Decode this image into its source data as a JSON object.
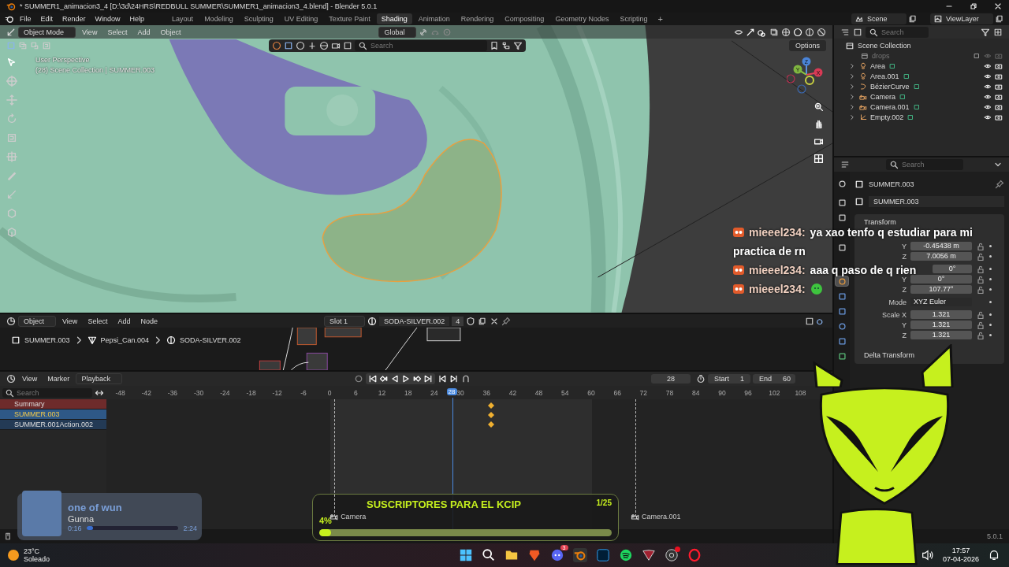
{
  "window": {
    "title": "* SUMMER1_animacion3_4 [D:\\3d\\24HRS\\REDBULL SUMMER\\SUMMER1_animacion3_4.blend] - Blender 5.0.1"
  },
  "menu": [
    "File",
    "Edit",
    "Render",
    "Window",
    "Help"
  ],
  "workspaces": [
    {
      "label": "Layout",
      "selected": false
    },
    {
      "label": "Modeling",
      "selected": false
    },
    {
      "label": "Sculpting",
      "selected": false
    },
    {
      "label": "UV Editing",
      "selected": false
    },
    {
      "label": "Texture Paint",
      "selected": false
    },
    {
      "label": "Shading",
      "selected": true
    },
    {
      "label": "Animation",
      "selected": false
    },
    {
      "label": "Rendering",
      "selected": false
    },
    {
      "label": "Compositing",
      "selected": false
    },
    {
      "label": "Geometry Nodes",
      "selected": false
    },
    {
      "label": "Scripting",
      "selected": false
    }
  ],
  "add_workspace": "+",
  "scene": "Scene",
  "view_layer": "ViewLayer",
  "viewport": {
    "mode": "Object Mode",
    "menus": [
      "View",
      "Select",
      "Add",
      "Object"
    ],
    "orientation": "Global",
    "search_placeholder": "Search",
    "options": "Options",
    "perspective": "User Perspective",
    "collection_info": "(28) Scene Collection | SUMMER.003",
    "gizmo_axes": [
      "Z",
      "Y",
      "X"
    ]
  },
  "outliner": {
    "search_placeholder": "Search",
    "root": "Scene Collection",
    "items": [
      {
        "name": "drops",
        "kind": "collection",
        "disabled": true
      },
      {
        "name": "Area",
        "kind": "light",
        "disabled": false
      },
      {
        "name": "Area.001",
        "kind": "light",
        "disabled": false
      },
      {
        "name": "BézierCurve",
        "kind": "curve",
        "disabled": false
      },
      {
        "name": "Camera",
        "kind": "camera",
        "disabled": false
      },
      {
        "name": "Camera.001",
        "kind": "camera",
        "disabled": false
      },
      {
        "name": "Empty.002",
        "kind": "empty",
        "disabled": false
      }
    ]
  },
  "properties": {
    "search_placeholder": "Search",
    "tab_groups": [
      [
        {
          "selected": false,
          "covered": false
        }
      ],
      [
        {
          "selected": false,
          "covered": false
        },
        {
          "selected": false,
          "covered": false
        },
        {
          "selected": false,
          "covered": true
        },
        {
          "selected": false,
          "covered": false
        },
        {
          "selected": false,
          "covered": true
        }
      ],
      [
        {
          "selected": true,
          "covered": false
        },
        {
          "selected": false,
          "covered": false
        },
        {
          "selected": false,
          "covered": false
        },
        {
          "selected": false,
          "covered": false
        },
        {
          "selected": false,
          "covered": false
        },
        {
          "selected": false,
          "covered": false
        }
      ]
    ],
    "object": "SUMMER.003",
    "object_field": "SUMMER.003",
    "panel": "Transform",
    "groups": [
      [
        {
          "kind": "blank"
        },
        {
          "kind": "field",
          "label": "Y",
          "value": "-0.45438 m"
        },
        {
          "kind": "field",
          "label": "Z",
          "value": "7.0056 m"
        }
      ],
      [
        {
          "kind": "stub",
          "value": "0°"
        },
        {
          "kind": "field",
          "label": "Y",
          "value": "0°"
        },
        {
          "kind": "field",
          "label": "Z",
          "value": "107.77°"
        }
      ],
      [
        {
          "kind": "select",
          "label": "Mode",
          "value": "XYZ Euler"
        }
      ],
      [
        {
          "kind": "field",
          "label": "Scale X",
          "value": "1.321"
        },
        {
          "kind": "field",
          "label": "Y",
          "value": "1.321"
        },
        {
          "kind": "field",
          "label": "Z",
          "value": "1.321"
        }
      ]
    ],
    "subpanel": "Delta Transform"
  },
  "node_editor": {
    "object_menu": "Object",
    "menus": [
      "View",
      "Select",
      "Add",
      "Node"
    ],
    "slot": "Slot 1",
    "material": "SODA-SILVER.002",
    "users": "4",
    "breadcrumbs": [
      "SUMMER.003",
      "Pepsi_Can.004",
      "SODA-SILVER.002"
    ]
  },
  "timeline": {
    "menus": [
      "View",
      "Marker"
    ],
    "playback": "Playback",
    "current_frame": "28",
    "start_label": "Start",
    "start": "1",
    "end_label": "End",
    "end": "60",
    "search_placeholder": "Search",
    "playhead": "28",
    "ticks": [
      "-48",
      "-42",
      "-36",
      "-30",
      "-24",
      "-18",
      "-12",
      "-6",
      "0",
      "6",
      "12",
      "18",
      "24",
      "30",
      "36",
      "42",
      "48",
      "54",
      "60",
      "66",
      "72",
      "78",
      "84",
      "90",
      "96",
      "102",
      "108"
    ],
    "channels": [
      {
        "name": "Summary",
        "kind": "summary",
        "selected": false
      },
      {
        "name": "SUMMER.003",
        "kind": "object",
        "selected": true
      },
      {
        "name": "SUMMER.001Action.002",
        "kind": "action",
        "selected": false
      }
    ],
    "markers": [
      "Camera",
      "Camera.001"
    ]
  },
  "status": {
    "version": "5.0.1"
  },
  "chat": [
    {
      "user": "mieeel234:",
      "kind": "text",
      "lines": [
        "ya xao tenfo q estudiar para mi",
        "practica de rn"
      ]
    },
    {
      "user": "mieeel234:",
      "kind": "text",
      "lines": [
        "aaa q paso de q rien"
      ]
    },
    {
      "user": "mieeel234:",
      "kind": "emoji"
    }
  ],
  "music": {
    "title": "one of wun",
    "artist": "Gunna",
    "elapsed": "0:16",
    "total": "2:24",
    "level": 0.07
  },
  "goal": {
    "title": "SUSCRIPTORES PARA EL KCIP",
    "count": "1/25",
    "percent": "4%",
    "level": 0.04
  },
  "taskbar": {
    "temperature": "23°C",
    "weather": "Soleado",
    "discord_badge": "3",
    "time": "17:57",
    "date": "07-04-2026"
  }
}
